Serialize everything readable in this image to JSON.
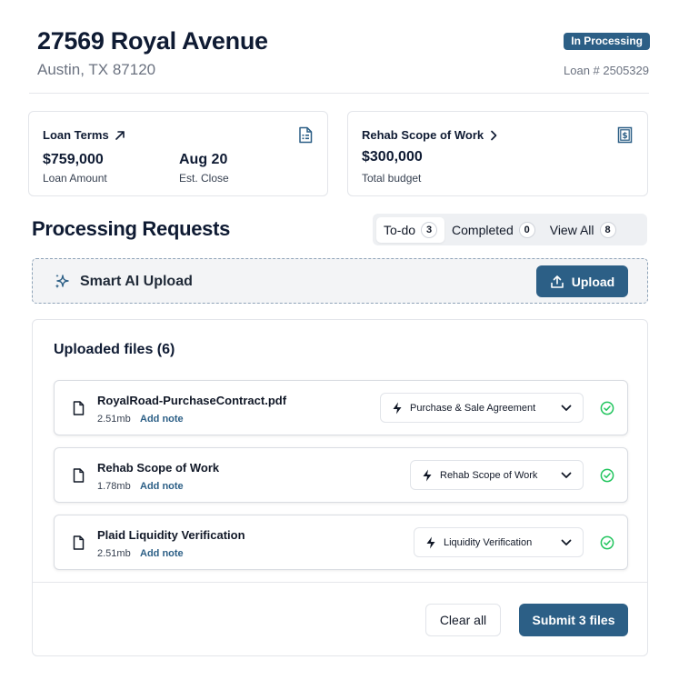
{
  "property": {
    "title": "27569 Royal Avenue",
    "subtitle": "Austin, TX 87120",
    "status": "In Processing",
    "loan_number": "Loan # 2505329"
  },
  "loan_terms": {
    "title": "Loan Terms",
    "icon": "document-icon",
    "amount_value": "$759,000",
    "amount_label": "Loan Amount",
    "close_value": "Aug 20",
    "close_label": "Est. Close"
  },
  "rehab": {
    "title": "Rehab Scope of Work",
    "icon": "receipt-icon",
    "budget_value": "$300,000",
    "budget_label": "Total budget"
  },
  "processing": {
    "title": "Processing Requests",
    "tabs": [
      {
        "label": "To-do",
        "count": "3"
      },
      {
        "label": "Completed",
        "count": "0"
      },
      {
        "label": "View All",
        "count": "8"
      }
    ]
  },
  "smart_upload": {
    "label": "Smart AI Upload",
    "button_label": "Upload"
  },
  "files": {
    "title": "Uploaded files (6)",
    "items": [
      {
        "name": "RoyalRoad-PurchaseContract.pdf",
        "size": "2.51mb",
        "note_label": "Add note",
        "doc_type": "Purchase & Sale Agreement"
      },
      {
        "name": "Rehab Scope of Work",
        "size": "1.78mb",
        "note_label": "Add note",
        "doc_type": "Rehab Scope of Work"
      },
      {
        "name": "Plaid Liquidity Verification",
        "size": "2.51mb",
        "note_label": "Add note",
        "doc_type": "Liquidity Verification"
      }
    ],
    "clear_label": "Clear all",
    "submit_label": "Submit 3 files"
  },
  "colors": {
    "primary": "#2c5f86",
    "success": "#22c55e",
    "heading": "#0f1b33"
  }
}
